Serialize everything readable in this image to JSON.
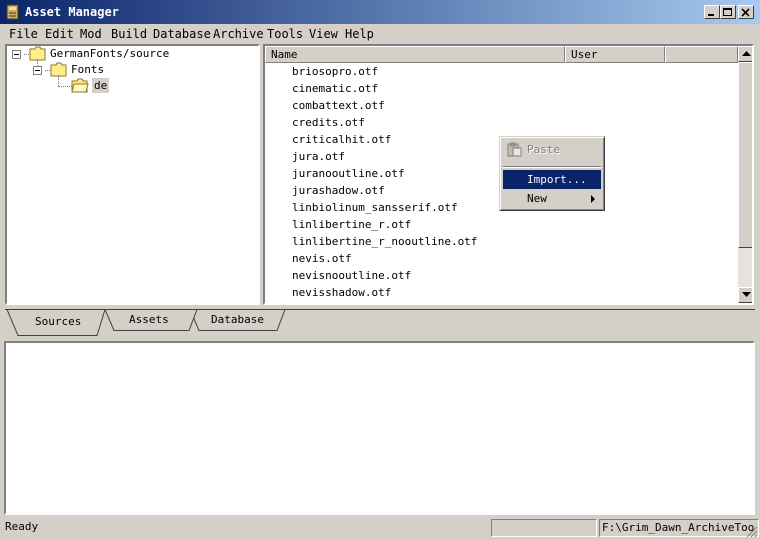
{
  "window": {
    "title": "Asset Manager"
  },
  "menu": [
    "File",
    "Edit",
    "Mod",
    "Build",
    "Database",
    "Archive",
    "Tools",
    "View",
    "Help"
  ],
  "tree": {
    "root": "GermanFonts/source",
    "child": "Fonts",
    "selected": "de"
  },
  "list": {
    "columns": [
      "Name",
      "User"
    ],
    "files": [
      "briosopro.otf",
      "cinematic.otf",
      "combattext.otf",
      "credits.otf",
      "criticalhit.otf",
      "jura.otf",
      "juranooutline.otf",
      "jurashadow.otf",
      "linbiolinum_sansserif.otf",
      "linlibertine_r.otf",
      "linlibertine_r_nooutline.otf",
      "nevis.otf",
      "nevisnooutline.otf",
      "nevisshadow.otf"
    ]
  },
  "context_menu": {
    "paste": "Paste",
    "import": "Import...",
    "new": "New"
  },
  "tabs": [
    "Sources",
    "Assets",
    "Database"
  ],
  "status": {
    "text": "Ready",
    "path": "F:\\Grim_Dawn_ArchiveToo"
  },
  "colors": {
    "title_start": "#0a246a",
    "title_end": "#a6caf0",
    "highlight": "#0a246a",
    "face": "#d4d0c8"
  }
}
